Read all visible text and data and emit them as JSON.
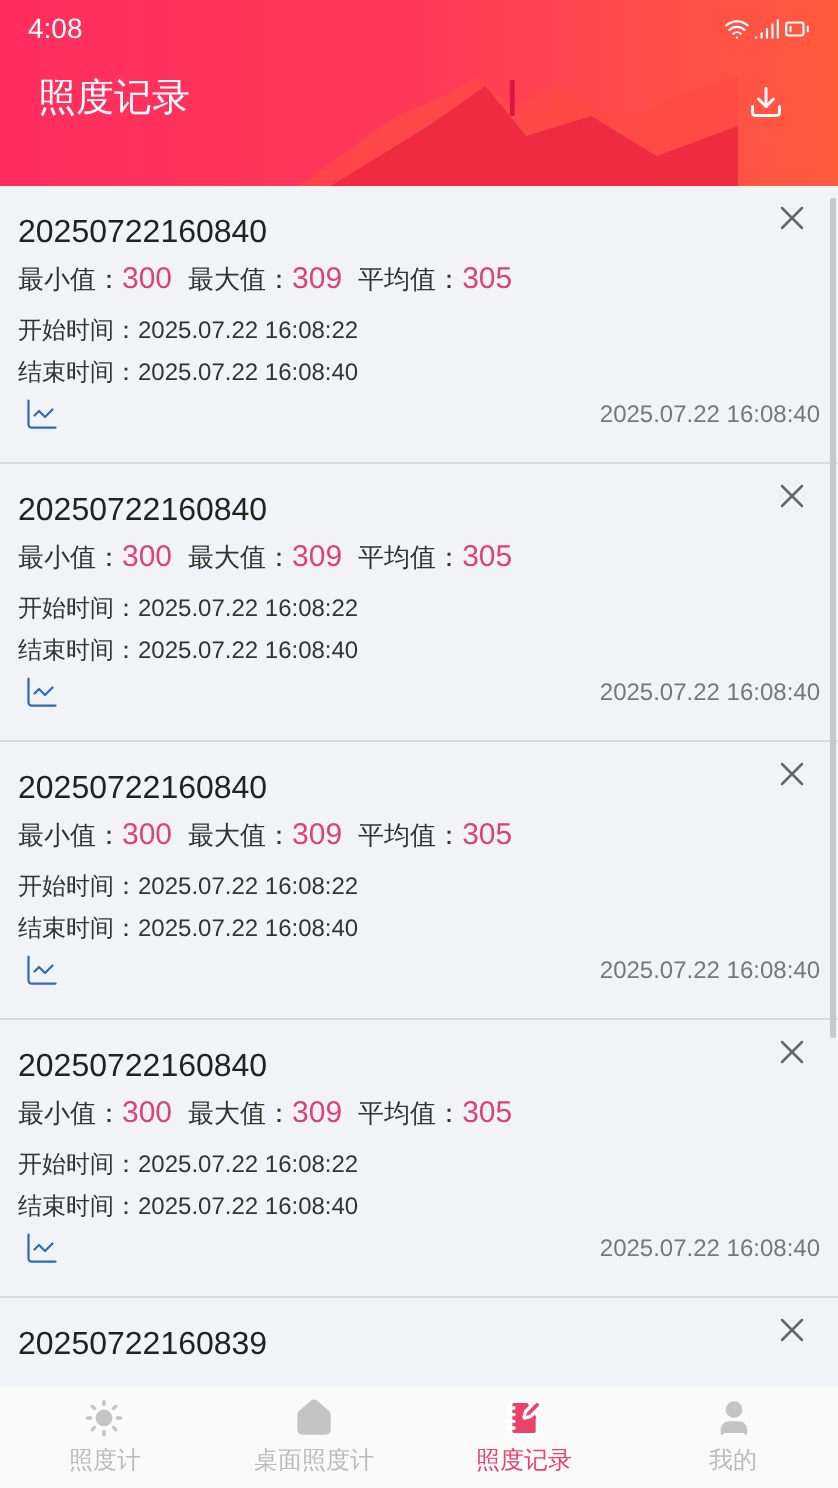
{
  "status_bar": {
    "time": "4:08"
  },
  "header": {
    "title": "照度记录"
  },
  "records": [
    {
      "id": "20250722160840",
      "min_label": "最小值：",
      "min": "300",
      "max_label": "最大值：",
      "max": "309",
      "avg_label": "平均值：",
      "avg": "305",
      "start_label": "开始时间：",
      "start": "2025.07.22 16:08:22",
      "end_label": "结束时间：",
      "end": "2025.07.22 16:08:40",
      "timestamp": "2025.07.22 16:08:40"
    },
    {
      "id": "20250722160840",
      "min_label": "最小值：",
      "min": "300",
      "max_label": "最大值：",
      "max": "309",
      "avg_label": "平均值：",
      "avg": "305",
      "start_label": "开始时间：",
      "start": "2025.07.22 16:08:22",
      "end_label": "结束时间：",
      "end": "2025.07.22 16:08:40",
      "timestamp": "2025.07.22 16:08:40"
    },
    {
      "id": "20250722160840",
      "min_label": "最小值：",
      "min": "300",
      "max_label": "最大值：",
      "max": "309",
      "avg_label": "平均值：",
      "avg": "305",
      "start_label": "开始时间：",
      "start": "2025.07.22 16:08:22",
      "end_label": "结束时间：",
      "end": "2025.07.22 16:08:40",
      "timestamp": "2025.07.22 16:08:40"
    },
    {
      "id": "20250722160840",
      "min_label": "最小值：",
      "min": "300",
      "max_label": "最大值：",
      "max": "309",
      "avg_label": "平均值：",
      "avg": "305",
      "start_label": "开始时间：",
      "start": "2025.07.22 16:08:22",
      "end_label": "结束时间：",
      "end": "2025.07.22 16:08:40",
      "timestamp": "2025.07.22 16:08:40"
    },
    {
      "id": "20250722160839"
    }
  ],
  "nav": [
    {
      "kind": "sun",
      "label": "照度计",
      "selected": false
    },
    {
      "kind": "house",
      "label": "桌面照度计",
      "selected": false
    },
    {
      "kind": "notebook",
      "label": "照度记录",
      "selected": true
    },
    {
      "kind": "person",
      "label": "我的",
      "selected": false
    }
  ]
}
